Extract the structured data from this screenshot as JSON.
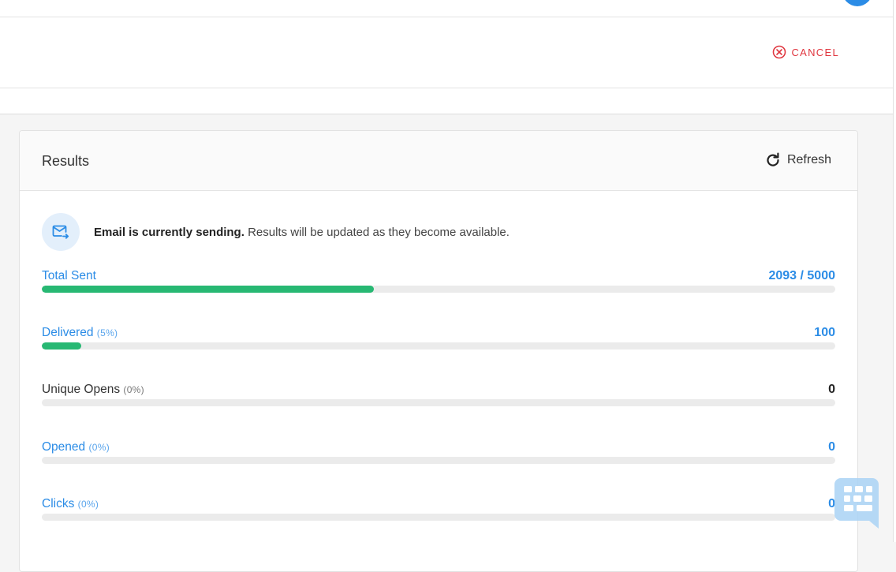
{
  "header": {
    "cancel_label": "CANCEL"
  },
  "results": {
    "title": "Results",
    "refresh_label": "Refresh",
    "notice_bold": "Email is currently sending.",
    "notice_rest": " Results will be updated as they become available.",
    "metrics": [
      {
        "label": "Total Sent",
        "pct": "",
        "value": "2093 / 5000",
        "progress": 0.4186,
        "style": "blue"
      },
      {
        "label": "Delivered",
        "pct": "(5%)",
        "value": "100",
        "progress": 0.05,
        "style": "blue"
      },
      {
        "label": "Unique Opens",
        "pct": "(0%)",
        "value": "0",
        "progress": 0,
        "style": "dark"
      },
      {
        "label": "Opened",
        "pct": "(0%)",
        "value": "0",
        "progress": 0,
        "style": "blue"
      },
      {
        "label": "Clicks",
        "pct": "(0%)",
        "value": "0",
        "progress": 0,
        "style": "blue"
      }
    ]
  },
  "icons": {
    "cancel": "circle-x-icon",
    "refresh": "refresh-icon",
    "mail": "mail-send-icon",
    "chat": "chat-widget-icon"
  },
  "colors": {
    "accent_blue": "#2b8ce6",
    "progress_green": "#27b873",
    "cancel_red": "#e0363f"
  }
}
